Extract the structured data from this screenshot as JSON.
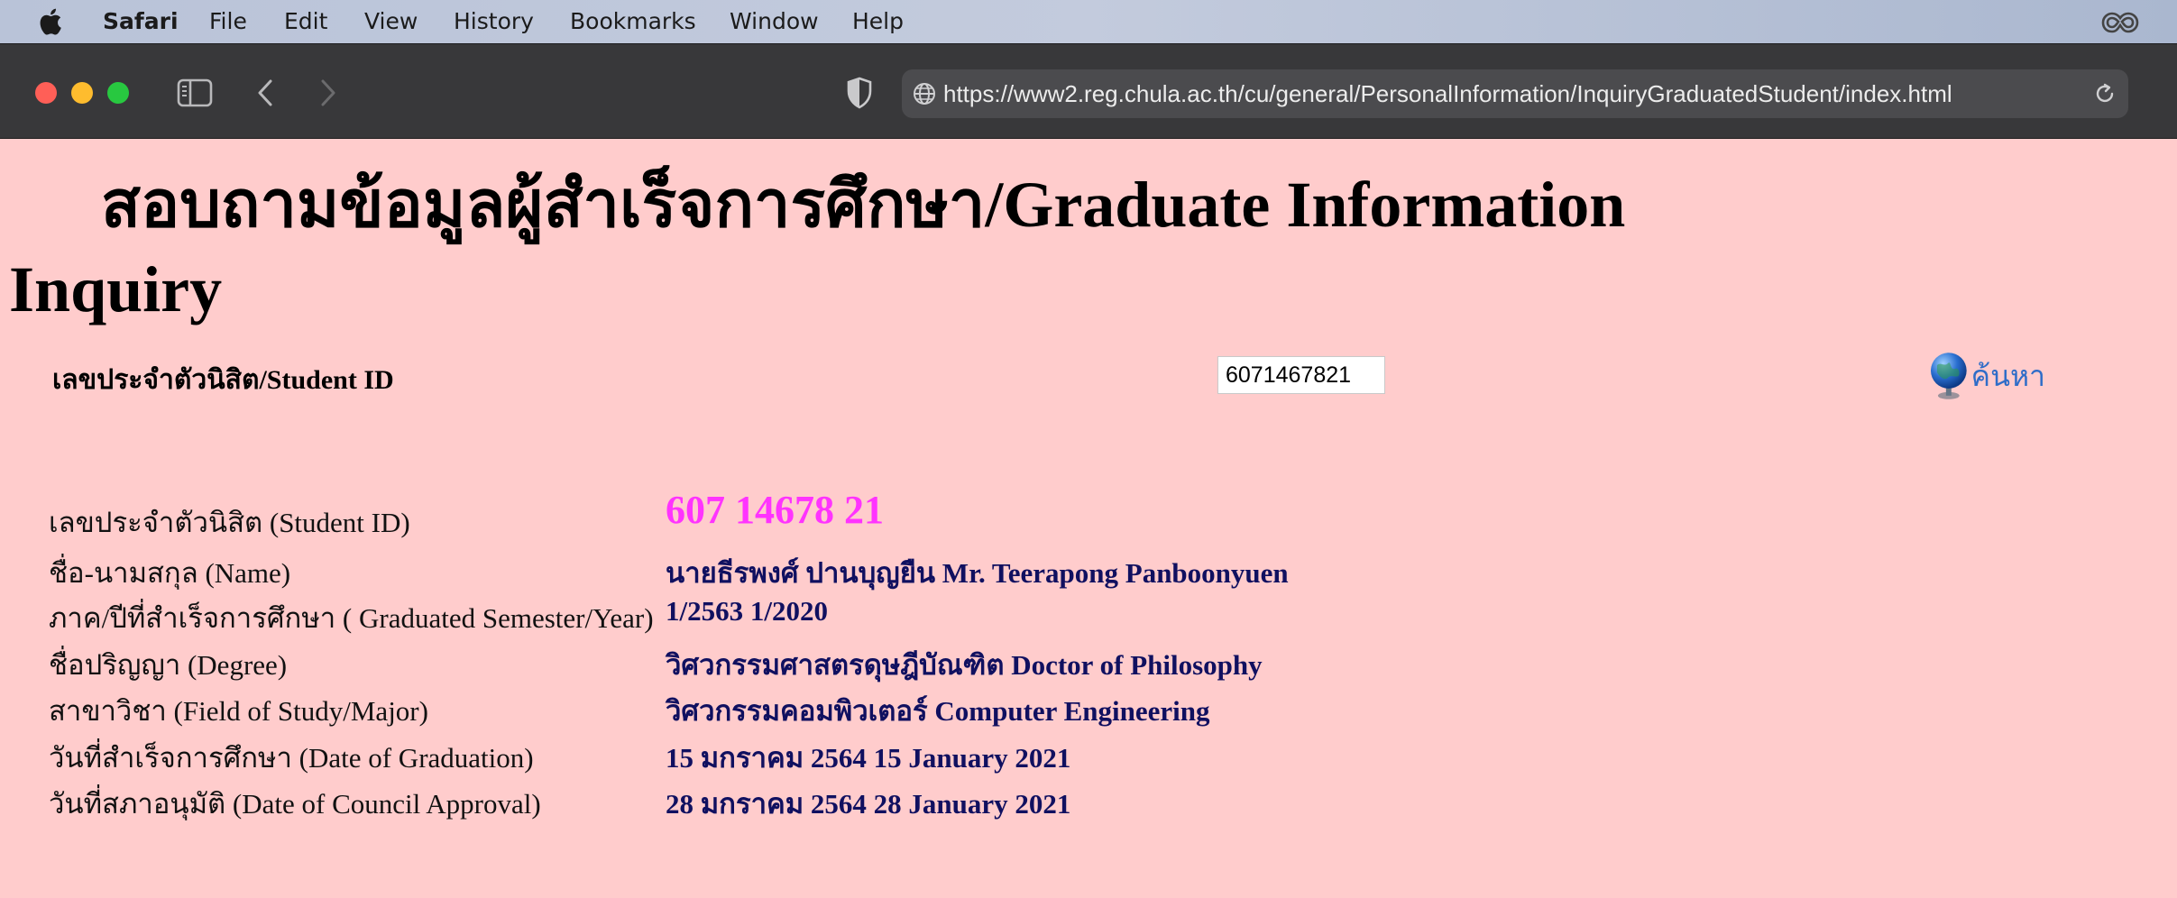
{
  "menubar": {
    "items": [
      "Safari",
      "File",
      "Edit",
      "View",
      "History",
      "Bookmarks",
      "Window",
      "Help"
    ]
  },
  "browser": {
    "url": "https://www2.reg.chula.ac.th/cu/general/PersonalInformation/InquiryGraduatedStudent/index.html"
  },
  "page": {
    "title": "สอบถามข้อมูลผู้สำเร็จการศึกษา/Graduate Information Inquiry",
    "search": {
      "label": "เลขประจำตัวนิสิต/Student ID",
      "value": "6071467821",
      "button_label": "ค้นหา"
    },
    "rows": [
      {
        "label": "เลขประจำตัวนิสิต (Student ID)",
        "value": "607 14678 21"
      },
      {
        "label": "ชื่อ-นามสกุล (Name)",
        "value": "นายธีรพงศ์ ปานบุญยืน  Mr. Teerapong Panboonyuen"
      },
      {
        "label": "ภาค/ปีที่สำเร็จการศึกษา ( Graduated Semester/Year)",
        "value": "1/2563  1/2020"
      },
      {
        "label": "ชื่อปริญญา (Degree)",
        "value": "วิศวกรรมศาสตรดุษฎีบัณฑิต  Doctor of Philosophy"
      },
      {
        "label": "สาขาวิชา (Field of Study/Major)",
        "value": "วิศวกรรมคอมพิวเตอร์  Computer Engineering"
      },
      {
        "label": "วันที่สำเร็จการศึกษา (Date of Graduation)",
        "value": "15 มกราคม 2564   15 January 2021"
      },
      {
        "label": "วันที่สภาอนุมัติ (Date of Council Approval)",
        "value": "28 มกราคม 2564   28 January 2021"
      }
    ]
  },
  "colors": {
    "page_background": "#ffcccc",
    "value_text": "#101060",
    "student_id_highlight": "#ff33ff",
    "search_link": "#2f6dc8"
  },
  "icons": [
    "apple-icon",
    "creative-cloud-icon",
    "sidebar-icon",
    "back-icon",
    "forward-icon",
    "privacy-shield-icon",
    "globe-icon",
    "reload-icon",
    "search-globe-icon"
  ]
}
